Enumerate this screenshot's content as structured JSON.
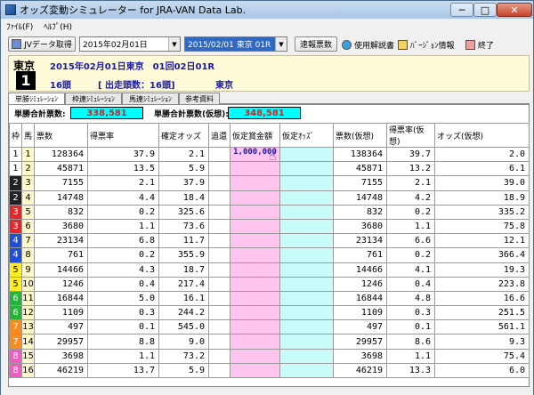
{
  "window": {
    "title": "オッズ変動シミュレーター for JRA-VAN Data Lab.",
    "min_label": "─",
    "max_label": "□",
    "close_label": "✕"
  },
  "menu": [
    "ﾌｧｲﾙ(F)",
    "ﾍﾙﾌﾟ(H)"
  ],
  "toolbar": {
    "jv_label": "JVデータ取得",
    "date_value": "2015年02月01日",
    "race_value": "2015/02/01 東京 01R",
    "quick_label": "速報票数",
    "help_label": "使用解説書",
    "version_label": "ﾊﾞｰｼﾞｮﾝ情報",
    "exit_label": "終了"
  },
  "race": {
    "track": "東京",
    "number": "1",
    "date_line": "2015年02月01日東京　01回02日01R",
    "heads": "16頭",
    "starters": "[ 出走頭数：16頭]",
    "venue": "東京"
  },
  "tabs": [
    "単勝ｼﾐｭﾚｰｼｮﾝ",
    "枠連ｼﾐｭﾚｰｼｮﾝ",
    "馬連ｼﾐｭﾚｰｼｮﾝ",
    "参考資料"
  ],
  "summary": {
    "total_label": "単勝合計票数:",
    "total_value": "338,581",
    "virtual_label": "単勝合計票数(仮想):",
    "virtual_value": "348,581"
  },
  "columns": [
    "枠",
    "馬",
    "票数",
    "得票率",
    "確定オッズ",
    "追還",
    "仮定賞金額",
    "仮定ｵｯｽﾞ",
    "票数(仮想)",
    "得票率(仮想)",
    "オッズ(仮想)"
  ],
  "input_value": "1,000,000",
  "frame_colors": {
    "1": {
      "bg": "#ffffff",
      "fg": "#000000"
    },
    "2": {
      "bg": "#222222",
      "fg": "#ffffff"
    },
    "3": {
      "bg": "#e8262a",
      "fg": "#ffffff"
    },
    "4": {
      "bg": "#1f4fd6",
      "fg": "#ffffff"
    },
    "5": {
      "bg": "#ffee22",
      "fg": "#000000"
    },
    "6": {
      "bg": "#27b33b",
      "fg": "#ffffff"
    },
    "7": {
      "bg": "#f88a1e",
      "fg": "#ffffff"
    },
    "8": {
      "bg": "#f25ac0",
      "fg": "#ffffff"
    }
  },
  "rows": [
    {
      "waku": "1",
      "uma": "1",
      "votes": "128364",
      "rate": "37.9",
      "odds": "2.1",
      "votes_v": "138364",
      "rate_v": "39.7",
      "odds_v": "2.0"
    },
    {
      "waku": "1",
      "uma": "2",
      "votes": "45871",
      "rate": "13.5",
      "odds": "5.9",
      "votes_v": "45871",
      "rate_v": "13.2",
      "odds_v": "6.1"
    },
    {
      "waku": "2",
      "uma": "3",
      "votes": "7155",
      "rate": "2.1",
      "odds": "37.9",
      "votes_v": "7155",
      "rate_v": "2.1",
      "odds_v": "39.0"
    },
    {
      "waku": "2",
      "uma": "4",
      "votes": "14748",
      "rate": "4.4",
      "odds": "18.4",
      "votes_v": "14748",
      "rate_v": "4.2",
      "odds_v": "18.9"
    },
    {
      "waku": "3",
      "uma": "5",
      "votes": "832",
      "rate": "0.2",
      "odds": "325.6",
      "votes_v": "832",
      "rate_v": "0.2",
      "odds_v": "335.2"
    },
    {
      "waku": "3",
      "uma": "6",
      "votes": "3680",
      "rate": "1.1",
      "odds": "73.6",
      "votes_v": "3680",
      "rate_v": "1.1",
      "odds_v": "75.8"
    },
    {
      "waku": "4",
      "uma": "7",
      "votes": "23134",
      "rate": "6.8",
      "odds": "11.7",
      "votes_v": "23134",
      "rate_v": "6.6",
      "odds_v": "12.1"
    },
    {
      "waku": "4",
      "uma": "8",
      "votes": "761",
      "rate": "0.2",
      "odds": "355.9",
      "votes_v": "761",
      "rate_v": "0.2",
      "odds_v": "366.4"
    },
    {
      "waku": "5",
      "uma": "9",
      "votes": "14466",
      "rate": "4.3",
      "odds": "18.7",
      "votes_v": "14466",
      "rate_v": "4.1",
      "odds_v": "19.3"
    },
    {
      "waku": "5",
      "uma": "10",
      "votes": "1246",
      "rate": "0.4",
      "odds": "217.4",
      "votes_v": "1246",
      "rate_v": "0.4",
      "odds_v": "223.8"
    },
    {
      "waku": "6",
      "uma": "11",
      "votes": "16844",
      "rate": "5.0",
      "odds": "16.1",
      "votes_v": "16844",
      "rate_v": "4.8",
      "odds_v": "16.6"
    },
    {
      "waku": "6",
      "uma": "12",
      "votes": "1109",
      "rate": "0.3",
      "odds": "244.2",
      "votes_v": "1109",
      "rate_v": "0.3",
      "odds_v": "251.5"
    },
    {
      "waku": "7",
      "uma": "13",
      "votes": "497",
      "rate": "0.1",
      "odds": "545.0",
      "votes_v": "497",
      "rate_v": "0.1",
      "odds_v": "561.1"
    },
    {
      "waku": "7",
      "uma": "14",
      "votes": "29957",
      "rate": "8.8",
      "odds": "9.0",
      "votes_v": "29957",
      "rate_v": "8.6",
      "odds_v": "9.3"
    },
    {
      "waku": "8",
      "uma": "15",
      "votes": "3698",
      "rate": "1.1",
      "odds": "73.2",
      "votes_v": "3698",
      "rate_v": "1.1",
      "odds_v": "75.4"
    },
    {
      "waku": "8",
      "uma": "16",
      "votes": "46219",
      "rate": "13.7",
      "odds": "5.9",
      "votes_v": "46219",
      "rate_v": "13.3",
      "odds_v": "6.0"
    }
  ]
}
